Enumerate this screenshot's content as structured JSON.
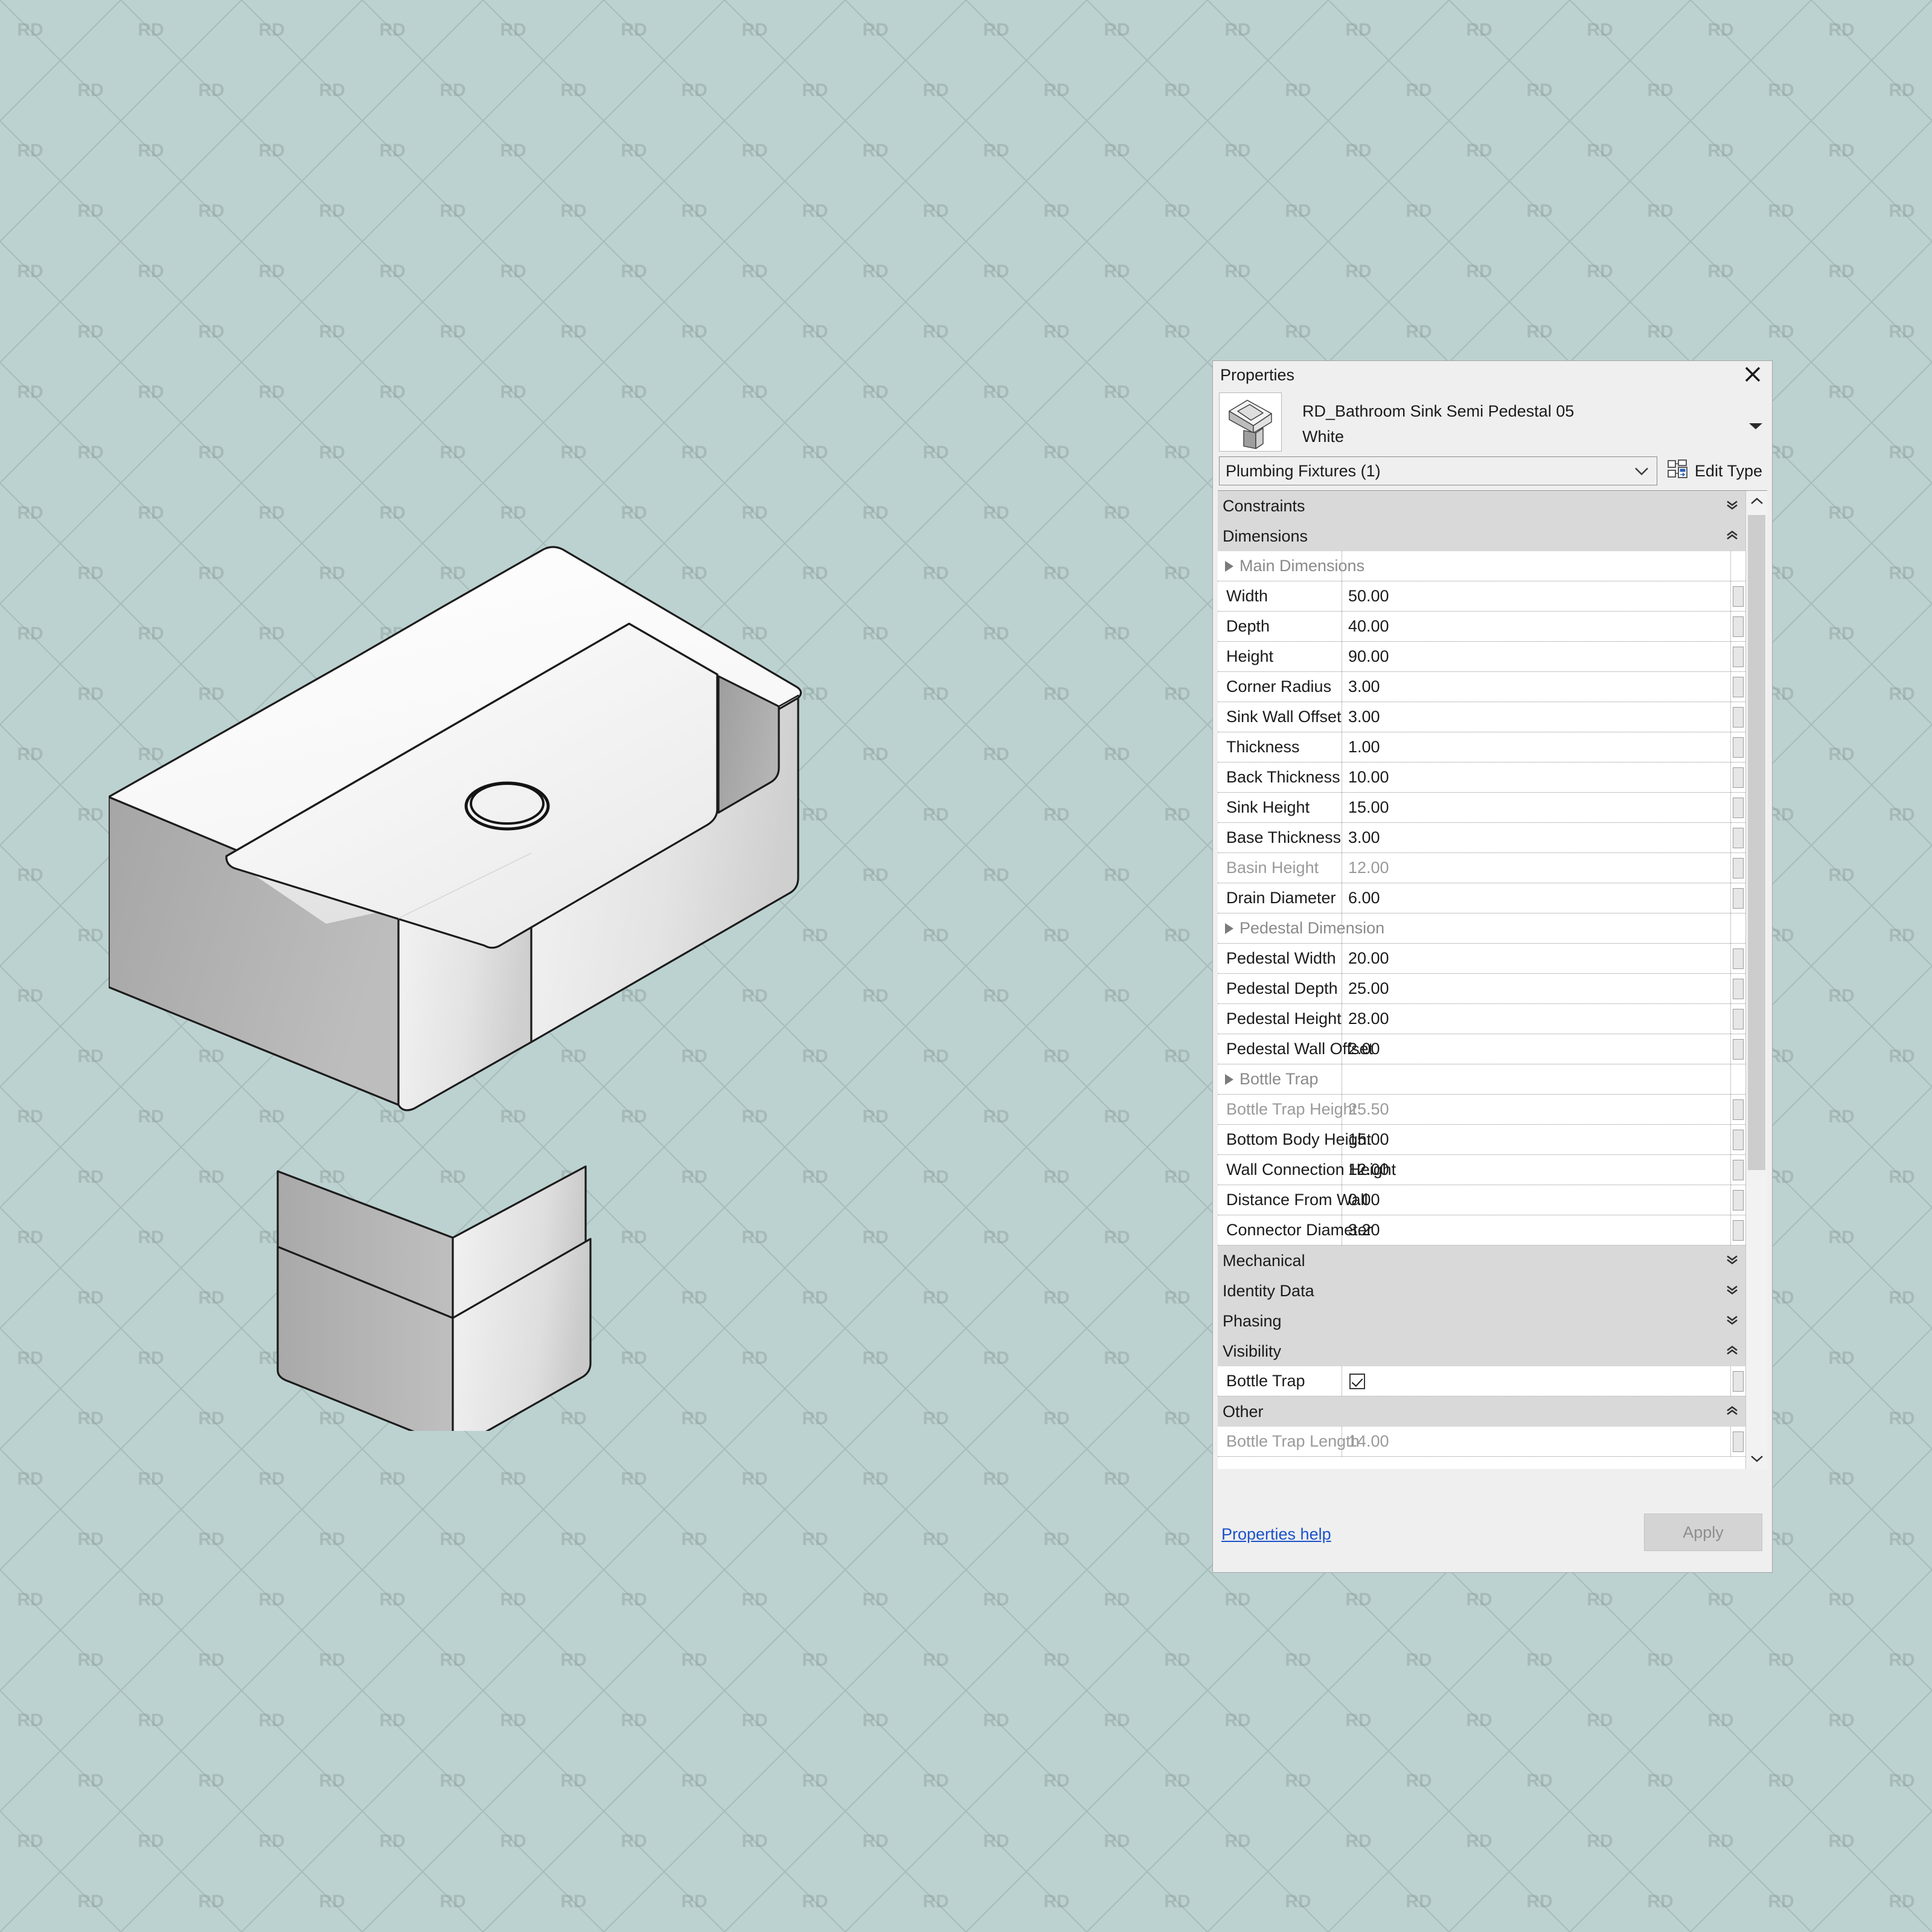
{
  "background": {
    "color": "#bcd2d0",
    "watermark_text": "RD"
  },
  "panel": {
    "title": "Properties",
    "close_icon": "close-icon",
    "type_name": "RD_Bathroom Sink Semi Pedestal 05 White",
    "type_name_line1": "RD_Bathroom Sink Semi Pedestal 05",
    "type_name_line2": "White",
    "type_selector_arrow_icon": "chevron-down-icon",
    "category": "Plumbing Fixtures (1)",
    "category_chevron_icon": "chevron-down-icon",
    "edit_type_label": "Edit Type",
    "edit_type_icon": "edit-type-icon",
    "properties_help_label": "Properties help",
    "apply_label": "Apply",
    "apply_enabled": false
  },
  "groups": [
    {
      "name": "Constraints",
      "state_icon": "chevrons-down-icon",
      "expanded": false
    },
    {
      "name": "Dimensions",
      "state_icon": "chevrons-up-icon",
      "expanded": true
    },
    {
      "name": "Mechanical",
      "state_icon": "chevrons-down-icon",
      "expanded": false
    },
    {
      "name": "Identity Data",
      "state_icon": "chevrons-down-icon",
      "expanded": false
    },
    {
      "name": "Phasing",
      "state_icon": "chevrons-down-icon",
      "expanded": false
    },
    {
      "name": "Visibility",
      "state_icon": "chevrons-up-icon",
      "expanded": true
    },
    {
      "name": "Other",
      "state_icon": "chevrons-up-icon",
      "expanded": true
    }
  ],
  "dimensions_rows": [
    {
      "label": "Main Dimensions",
      "value": "",
      "kind": "subheader",
      "disabled": true
    },
    {
      "label": "Width",
      "value": "50.00",
      "kind": "value",
      "disabled": false
    },
    {
      "label": "Depth",
      "value": "40.00",
      "kind": "value",
      "disabled": false
    },
    {
      "label": "Height",
      "value": "90.00",
      "kind": "value",
      "disabled": false
    },
    {
      "label": "Corner Radius",
      "value": "3.00",
      "kind": "value",
      "disabled": false
    },
    {
      "label": "Sink Wall Offset",
      "value": "3.00",
      "kind": "value",
      "disabled": false
    },
    {
      "label": "Thickness",
      "value": "1.00",
      "kind": "value",
      "disabled": false
    },
    {
      "label": "Back Thickness",
      "value": "10.00",
      "kind": "value",
      "disabled": false
    },
    {
      "label": "Sink Height",
      "value": "15.00",
      "kind": "value",
      "disabled": false
    },
    {
      "label": "Base Thickness",
      "value": "3.00",
      "kind": "value",
      "disabled": false
    },
    {
      "label": "Basin Height",
      "value": "12.00",
      "kind": "value",
      "disabled": true
    },
    {
      "label": "Drain Diameter",
      "value": "6.00",
      "kind": "value",
      "disabled": false
    },
    {
      "label": "Pedestal Dimension",
      "value": "",
      "kind": "subheader",
      "disabled": true
    },
    {
      "label": "Pedestal Width",
      "value": "20.00",
      "kind": "value",
      "disabled": false
    },
    {
      "label": "Pedestal Depth",
      "value": "25.00",
      "kind": "value",
      "disabled": false
    },
    {
      "label": "Pedestal Height",
      "value": "28.00",
      "kind": "value",
      "disabled": false
    },
    {
      "label": "Pedestal Wall Offset",
      "value": "2.00",
      "kind": "value",
      "disabled": false
    },
    {
      "label": "Bottle Trap",
      "value": "",
      "kind": "subheader",
      "disabled": true
    },
    {
      "label": "Bottle Trap Height",
      "value": "25.50",
      "kind": "value",
      "disabled": true
    },
    {
      "label": "Bottom Body Height",
      "value": "15.00",
      "kind": "value",
      "disabled": false
    },
    {
      "label": "Wall Connection Height",
      "value": "12.00",
      "kind": "value",
      "disabled": false
    },
    {
      "label": "Distance From Wall",
      "value": "0.00",
      "kind": "value",
      "disabled": false
    },
    {
      "label": "Connector Diameter",
      "value": "3.20",
      "kind": "value",
      "disabled": false
    }
  ],
  "visibility_rows": [
    {
      "label": "Bottle Trap",
      "value": "",
      "kind": "checkbox",
      "checked": true,
      "disabled": false
    }
  ],
  "other_rows": [
    {
      "label": "Bottle Trap Length",
      "value": "14.00",
      "kind": "value",
      "disabled": true
    }
  ],
  "scrollbar": {
    "up_icon": "chevron-up-icon",
    "down_icon": "chevron-down-icon"
  },
  "model_view": {
    "object": "bathroom-sink-semi-pedestal",
    "drain_icon": "drain-ring"
  }
}
